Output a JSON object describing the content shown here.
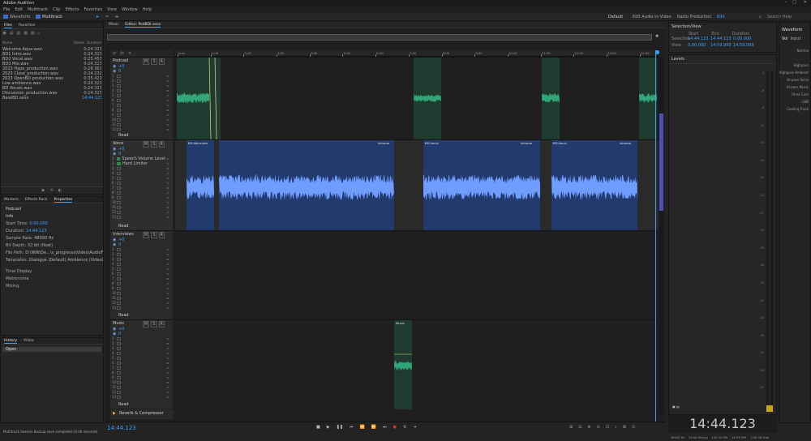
{
  "window": {
    "title": "Adobe Audition",
    "controls": [
      "–",
      "□",
      "✕"
    ]
  },
  "menu": [
    "File",
    "Edit",
    "Multitrack",
    "Clip",
    "Effects",
    "Favorites",
    "View",
    "Window",
    "Help"
  ],
  "toolbar": {
    "waveform_label": "Waveform",
    "multitrack_label": "Multitrack",
    "workspace_default": "Default",
    "workspace_learn": "Edit Audio to Video",
    "workspace_radio": "Radio Production",
    "workspace_more": "Edit",
    "search_placeholder": "Search Help"
  },
  "files_panel": {
    "tabs": [
      "Files",
      "Favorites"
    ],
    "columns": {
      "name": "Name",
      "status": "Status",
      "duration": "Duration"
    },
    "rows": [
      {
        "name": "Welcome Aqua.wav",
        "duration": "0:24.323"
      },
      {
        "name": "BD1 Intro.wav",
        "duration": "0:24.323"
      },
      {
        "name": "BD2 Vocal.wav",
        "duration": "0:25.453"
      },
      {
        "name": "BD3 Mix.wav",
        "duration": "0:24.323"
      },
      {
        "name": "2023 Hype_production.wav",
        "duration": "0:28.363"
      },
      {
        "name": "2023 Close_production.wav",
        "duration": "0:24.232"
      },
      {
        "name": "2023 OpenBD production.wav",
        "duration": "0:35.421"
      },
      {
        "name": "Low ambience.wav",
        "duration": "0:24.323"
      },
      {
        "name": "BD Vocals.wav",
        "duration": "0:24.323"
      },
      {
        "name": "Discussion_production.wav",
        "duration": "0:24.323"
      },
      {
        "name": "BaseBD.sesx",
        "duration": "14:44.123"
      }
    ]
  },
  "props_panel": {
    "tabs": [
      "Markers",
      "Effects Rack",
      "Properties"
    ],
    "heading": "Podcast",
    "section": "Info",
    "fields": [
      {
        "k": "Start Time:",
        "v": "0:00.000"
      },
      {
        "k": "Duration:",
        "v": "14:44.123"
      },
      {
        "k": "Sample Rate:",
        "v": "48000 Hz"
      },
      {
        "k": "Bit Depth:",
        "v": "32 bit (float)"
      },
      {
        "k": "File Path:",
        "v": "D:\\WIN\\De...\\s_progresss\\Video\\AudioFile.sesx"
      },
      {
        "k": "Templates:",
        "v": "Dialogue (Default) Ambience (Video)"
      }
    ],
    "groups": [
      "Time Display",
      "Metronome",
      "Mixing"
    ]
  },
  "history_panel": {
    "tabs": [
      "History",
      "Video"
    ],
    "item": "Open"
  },
  "status_left": "Multitrack Session Backup save completed (0.00 seconds)",
  "editor_tabs": [
    "Mixer",
    "Editor: PodBDI.sesx"
  ],
  "ruler_labels": [
    "hms",
    "1:00",
    "2:00",
    "3:00",
    "4:00",
    "5:00",
    "6:00",
    "7:00",
    "8:00",
    "9:00",
    "10:00",
    "11:00",
    "12:00",
    "13:00",
    "14:00"
  ],
  "tracks": [
    {
      "name": "Podcast",
      "vol": "+0",
      "pan": "0",
      "read": "Read",
      "send": "S",
      "input": "M"
    },
    {
      "name": "Voice",
      "vol": "+0",
      "pan": "0",
      "read": "Read",
      "send": "S",
      "input": "M",
      "effects": [
        "Speech Volume Leveler",
        "Hard Limiter"
      ]
    },
    {
      "name": "Interviews",
      "vol": "+0",
      "pan": "0",
      "read": "Read",
      "send": "S",
      "input": "M"
    },
    {
      "name": "Music",
      "vol": "+0",
      "pan": "0",
      "read": "Read",
      "send": "S",
      "input": "M"
    }
  ],
  "clip_labels": {
    "voice1": "BD-Voice.bm",
    "voice1b": "Volume",
    "voice2": "BD-Vocal",
    "voice2b": "Volume",
    "voice3": "BD-Vocal",
    "voice3b": "Volume",
    "music1": "Music"
  },
  "master": {
    "label": "Reverb & Compressor"
  },
  "transport": {
    "time": "14:44.123"
  },
  "selection_panel": {
    "title": "Selection/View",
    "cols": [
      "Start",
      "End",
      "Duration"
    ],
    "rows": [
      {
        "k": "Selection",
        "v": [
          "14:44.123",
          "14:44.123",
          "0:00.000"
        ]
      },
      {
        "k": "View",
        "v": [
          "0:00.000",
          "14:59.999",
          "14:59.999"
        ]
      }
    ]
  },
  "levels_panel": {
    "title": "Levels",
    "scale": [
      "-3",
      "-6",
      "-9",
      "-12",
      "-15",
      "-18",
      "-21",
      "-24",
      "-27",
      "-30",
      "-33",
      "-36",
      "-39",
      "-42",
      "-45",
      "-48",
      "-51",
      "-54",
      "-57"
    ]
  },
  "big_time": "14:44.123",
  "right_panel": {
    "title": "Waveform",
    "tabs": [
      "Vol",
      "Input"
    ],
    "items": [
      "Playback",
      "Normal",
      "Highpass",
      "Hard",
      "Highpass",
      "Invert",
      "Normalize"
    ],
    "subitems": [
      "Highpass",
      "Highpass Ambient",
      "Hi-pass Voice",
      "Hi-pass Music",
      "Three Cuts",
      "-3dB",
      "Cooling Track"
    ]
  },
  "status_right": {
    "hz": "48000 Hz",
    "bit": "32-bit Mixing",
    "mem": "155.22 MB",
    "dur": "14:59.999",
    "free": "1:58 GB free"
  },
  "colors": {
    "accent": "#3aa0ff",
    "green_clip": "#1f3a2e",
    "green_wave": "#33a57a",
    "blue_clip": "#2e4aa8",
    "blue_wave": "#6f9cff"
  }
}
